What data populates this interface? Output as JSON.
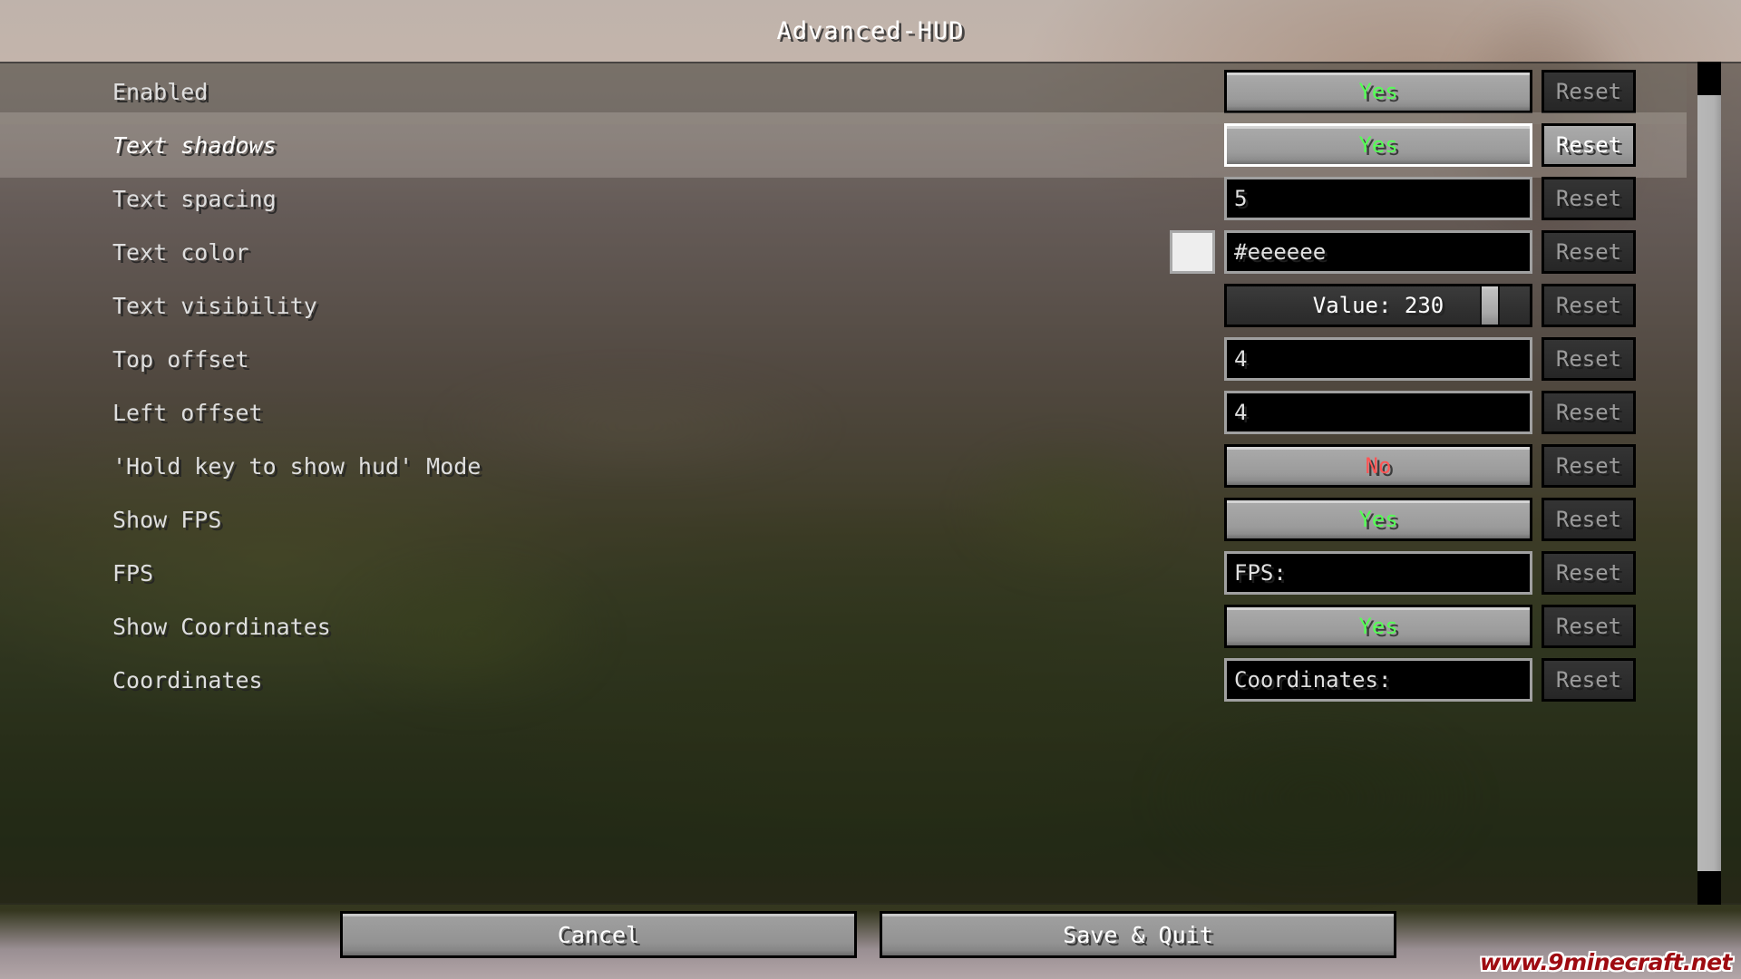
{
  "window": {
    "title": "Advanced-HUD"
  },
  "theme": {
    "value_yes_color": "#55ff55",
    "value_no_color": "#ff5555",
    "text_color_swatch": "#eeeeee",
    "watermark_color": "#9e0b11",
    "input_background": "#000000",
    "button_face": "#9b9b9b"
  },
  "reset_label": "Reset",
  "settings": [
    {
      "label": "Enabled",
      "control": "toggle",
      "value": "Yes",
      "value_state": "yes",
      "reset_enabled": false,
      "hovered": false,
      "shaded": true
    },
    {
      "label": "Text shadows",
      "control": "toggle",
      "value": "Yes",
      "value_state": "yes",
      "reset_enabled": true,
      "hovered": true,
      "shaded": false
    },
    {
      "label": "Text spacing",
      "control": "input",
      "value": "5",
      "reset_enabled": false,
      "hovered": false,
      "shaded": false
    },
    {
      "label": "Text color",
      "control": "input",
      "value": "#eeeeee",
      "swatch": "#eeeeee",
      "reset_enabled": false,
      "hovered": false,
      "shaded": false
    },
    {
      "label": "Text visibility",
      "control": "slider",
      "value": "Value: 230",
      "slider_percent": 90,
      "reset_enabled": false,
      "hovered": false,
      "shaded": false
    },
    {
      "label": "Top offset",
      "control": "input",
      "value": "4",
      "reset_enabled": false,
      "hovered": false,
      "shaded": false
    },
    {
      "label": "Left offset",
      "control": "input",
      "value": "4",
      "reset_enabled": false,
      "hovered": false,
      "shaded": false
    },
    {
      "label": "'Hold key to show hud' Mode",
      "control": "toggle",
      "value": "No",
      "value_state": "no",
      "reset_enabled": false,
      "hovered": false,
      "shaded": false
    },
    {
      "label": "Show FPS",
      "control": "toggle",
      "value": "Yes",
      "value_state": "yes",
      "reset_enabled": false,
      "hovered": false,
      "shaded": false
    },
    {
      "label": "FPS",
      "control": "input",
      "value": "FPS:",
      "reset_enabled": false,
      "hovered": false,
      "shaded": false
    },
    {
      "label": "Show Coordinates",
      "control": "toggle",
      "value": "Yes",
      "value_state": "yes",
      "reset_enabled": false,
      "hovered": false,
      "shaded": false
    },
    {
      "label": "Coordinates",
      "control": "input",
      "value": "Coordinates:",
      "reset_enabled": false,
      "hovered": false,
      "shaded": false
    }
  ],
  "scrollbar": {
    "thumb_top_percent": 4,
    "thumb_height_percent": 92
  },
  "footer": {
    "cancel_label": "Cancel",
    "save_label": "Save & Quit"
  },
  "watermark": {
    "text": "www.9minecraft.net"
  }
}
